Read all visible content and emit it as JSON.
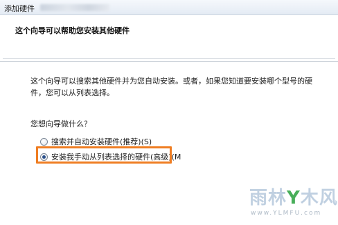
{
  "window": {
    "title": "添加硬件"
  },
  "header": {
    "title": "这个向导可以帮助您安装其他硬件"
  },
  "main": {
    "description": "这个向导可以搜索其他硬件并为您自动安装。或者，如果您知道要安装哪个型号的硬件，您可以从列表选择。",
    "question": "您想向导做什么？",
    "options": [
      {
        "label": "搜索并自动安装硬件(推荐)(S)",
        "selected": false
      },
      {
        "label": "安装我手动从列表选择的硬件(高级)(M",
        "selected": true
      }
    ],
    "highlight_color": "#ef7d22"
  },
  "watermark": {
    "text_left": "雨林",
    "text_y": "Y",
    "text_right": "木风",
    "url": "www.YLMFU.com"
  }
}
